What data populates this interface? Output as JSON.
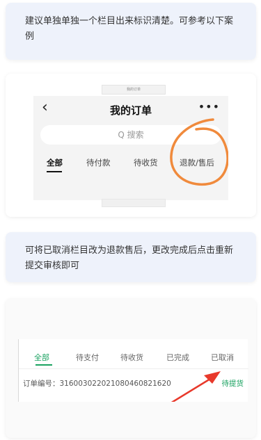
{
  "messages": [
    "建议单独单独一个栏目出来标识清楚。可参考以下案例",
    "可将已取消栏目改为退款售后，更改完成后点击重新提交审核即可"
  ],
  "example1": {
    "top_caption": "我的订单",
    "title": "我的订单",
    "back_icon": "‹",
    "more_icon": "•••",
    "search_placeholder": "Q 搜索",
    "tabs": [
      "全部",
      "待付款",
      "待收货",
      "退款/售后"
    ],
    "highlight_color": "#f08a3c"
  },
  "example2": {
    "tabs": [
      "全部",
      "待支付",
      "待收货",
      "已完成",
      "已取消"
    ],
    "order_label": "订单编号：31600302202108046082162​0",
    "order_status": "待提货",
    "accent_color": "#1aa260",
    "arrow_color": "#e8392b"
  }
}
